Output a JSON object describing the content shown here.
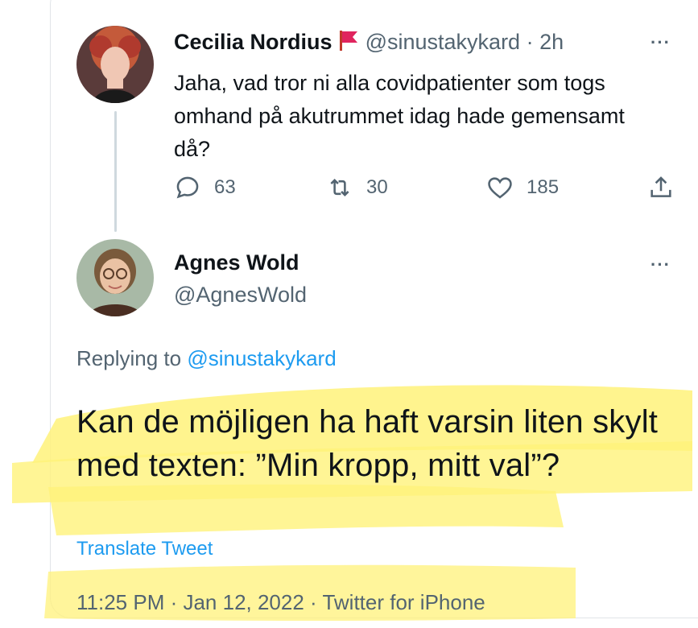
{
  "colors": {
    "accent": "#1d9bf0",
    "muted": "#536471",
    "highlight": "#fff27a",
    "flag": "#e0245e"
  },
  "tweet1": {
    "author_name": "Cecilia Nordius",
    "flag_icon": "red-flag-icon",
    "handle_time": "@sinustakykard · 2h",
    "more": "···",
    "text": "Jaha, vad tror ni alla covidpatienter som togs omhand på akutrummet idag hade gemensamt då?",
    "actions": {
      "replies": "63",
      "retweets": "30",
      "likes": "185"
    }
  },
  "tweet2": {
    "author_name": "Agnes Wold",
    "handle": "@AgnesWold",
    "more": "···",
    "replying_prefix": "Replying to ",
    "replying_handle": "@sinustakykard",
    "text": "Kan de möjligen ha haft varsin liten skylt med texten: ”Min kropp, mitt val”?",
    "translate": "Translate Tweet",
    "meta": "11:25 PM · Jan 12, 2022 · Twitter for iPhone"
  }
}
